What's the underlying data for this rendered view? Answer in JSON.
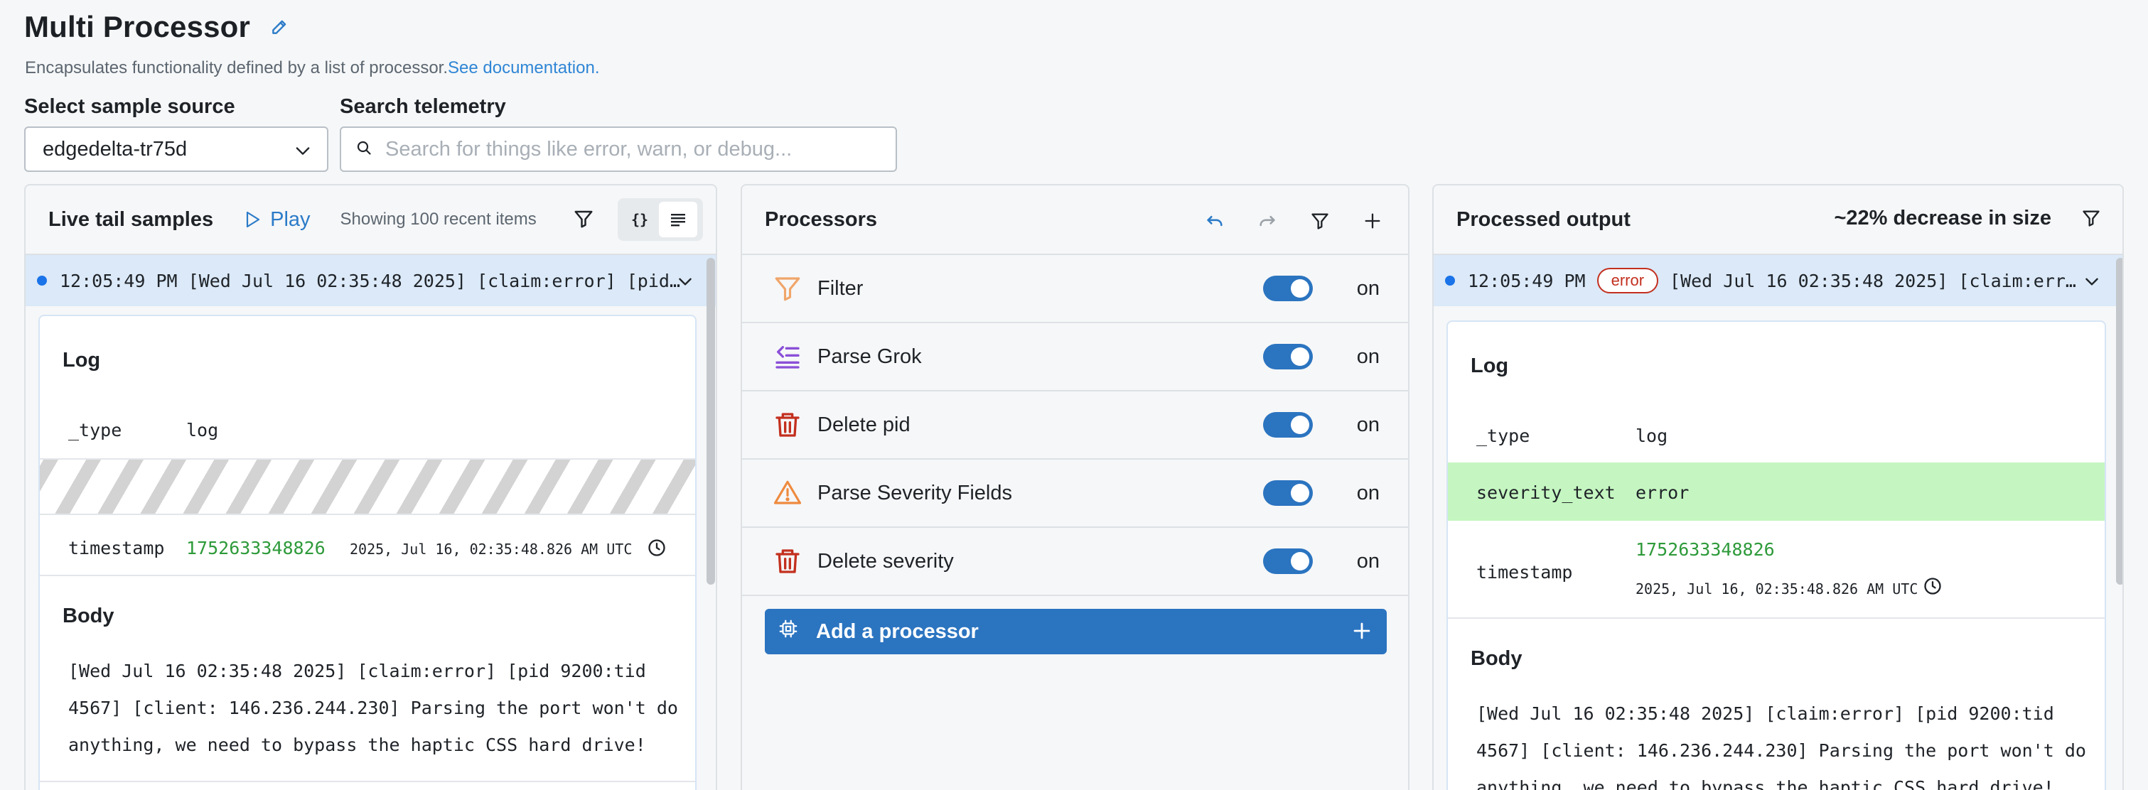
{
  "header": {
    "title": "Multi Processor",
    "description": "Encapsulates functionality defined by a list of processor.",
    "doc_link": "See documentation."
  },
  "source": {
    "label": "Select sample source",
    "value": "edgedelta-tr75d"
  },
  "search": {
    "label": "Search telemetry",
    "placeholder": "Search for things like error, warn, or debug..."
  },
  "live_tail": {
    "title": "Live tail samples",
    "play_label": "Play",
    "showing_text": "Showing 100 recent items",
    "view_json_label": "{}",
    "sample": {
      "time": "12:05:49 PM",
      "summary": "[Wed Jul 16 02:35:48 2025] [claim:error] [pid…"
    },
    "log": {
      "section_title": "Log",
      "type_key": "_type",
      "type_value": "log",
      "timestamp_key": "timestamp",
      "timestamp_value": "1752633348826",
      "timestamp_human": "2025, Jul 16, 02:35:48.826 AM UTC"
    },
    "body": {
      "section_title": "Body",
      "lines": [
        "[Wed Jul 16 02:35:48 2025] [claim:error] [pid 9200:tid",
        "4567] [client: 146.236.244.230] Parsing the port won't do",
        "anything, we need to bypass the haptic CSS hard drive!"
      ]
    }
  },
  "processors": {
    "title": "Processors",
    "items": [
      {
        "name": "Filter",
        "icon": "filter-icon",
        "state": "on"
      },
      {
        "name": "Parse Grok",
        "icon": "parse-grok-icon",
        "state": "on"
      },
      {
        "name": "Delete pid",
        "icon": "trash-icon",
        "state": "on"
      },
      {
        "name": "Parse Severity Fields",
        "icon": "warning-icon",
        "state": "on"
      },
      {
        "name": "Delete severity",
        "icon": "trash-icon",
        "state": "on"
      }
    ],
    "add_label": "Add a processor"
  },
  "output": {
    "title": "Processed output",
    "size_change": "~22% decrease in size",
    "sample": {
      "time": "12:05:49 PM",
      "badge": "error",
      "summary": "[Wed Jul 16 02:35:48 2025] [claim:err…"
    },
    "log": {
      "section_title": "Log",
      "type_key": "_type",
      "type_value": "log",
      "severity_key": "severity_text",
      "severity_value": "error",
      "timestamp_key": "timestamp",
      "timestamp_value": "1752633348826",
      "timestamp_human": "2025, Jul 16, 02:35:48.826 AM UTC"
    },
    "body": {
      "section_title": "Body",
      "lines": [
        "[Wed Jul 16 02:35:48 2025] [claim:error] [pid 9200:tid",
        "4567] [client: 146.236.244.230] Parsing the port won't do",
        "anything, we need to bypass the haptic CSS hard drive!"
      ]
    }
  },
  "colors": {
    "accent": "#2b74c0",
    "link": "#2f86d6",
    "highlight_added": "#c5f6c1",
    "error": "#c3301f",
    "timestamp_green": "#2e9a3a"
  }
}
